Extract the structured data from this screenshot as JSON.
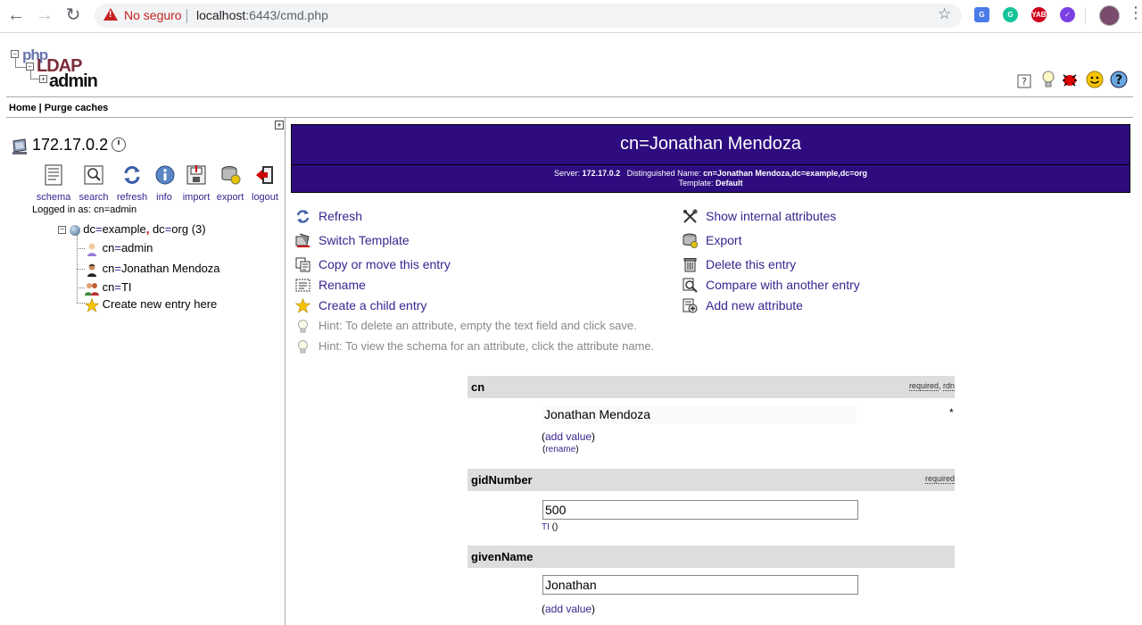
{
  "browser": {
    "insecure_label": "No seguro",
    "url_host": "localhost",
    "url_rest": ":6443/cmd.php"
  },
  "logo": {
    "php": "php",
    "ldap": "LDAP",
    "admin": "admin"
  },
  "menu": {
    "home": "Home",
    "separator": " | ",
    "purge": "Purge caches"
  },
  "server": {
    "name": "172.17.0.2",
    "tools": [
      "schema",
      "search",
      "refresh",
      "info",
      "import",
      "export",
      "logout"
    ],
    "logged_in": "Logged in as: cn=admin"
  },
  "tree": {
    "root": {
      "part1": "dc",
      "eq1": "=",
      "val1": "example",
      "comma": ",",
      "part2": " dc",
      "eq2": "=",
      "val2": "org",
      "count": " (3)"
    },
    "children": [
      {
        "attr": "cn",
        "eq": "=",
        "value": "admin"
      },
      {
        "attr": "cn",
        "eq": "=",
        "value": "Jonathan Mendoza"
      },
      {
        "attr": "cn",
        "eq": "=",
        "value": "TI"
      }
    ],
    "create_new": "Create new entry here"
  },
  "entry": {
    "title": "cn=Jonathan Mendoza",
    "server_label": "Server: ",
    "server_value": "172.17.0.2",
    "dn_label": "Distinguished Name: ",
    "dn_value": "cn=Jonathan Mendoza,dc=example,dc=org",
    "template_label": "Template: ",
    "template_value": "Default"
  },
  "actions_left": [
    "Refresh",
    "Switch Template",
    "Copy or move this entry",
    "Rename",
    "Create a child entry"
  ],
  "actions_right": [
    "Show internal attributes",
    "Export",
    "Delete this entry",
    "Compare with another entry",
    "Add new attribute"
  ],
  "hints": [
    "Hint: To delete an attribute, empty the text field and click save.",
    "Hint: To view the schema for an attribute, click the attribute name."
  ],
  "attributes": {
    "cn": {
      "name": "cn",
      "flag1": "required",
      "flag_sep": ", ",
      "flag2": "rdn",
      "value": "Jonathan Mendoza",
      "asterisk": "*",
      "add_value": "add value",
      "rename": "rename"
    },
    "gid": {
      "name": "gidNumber",
      "flag1": "required",
      "value": "500",
      "group": "TI",
      "group_paren": " ()"
    },
    "given": {
      "name": "givenName",
      "value": "Jonathan",
      "add_value": "add value"
    }
  },
  "paren_open": "(",
  "paren_close": ")"
}
